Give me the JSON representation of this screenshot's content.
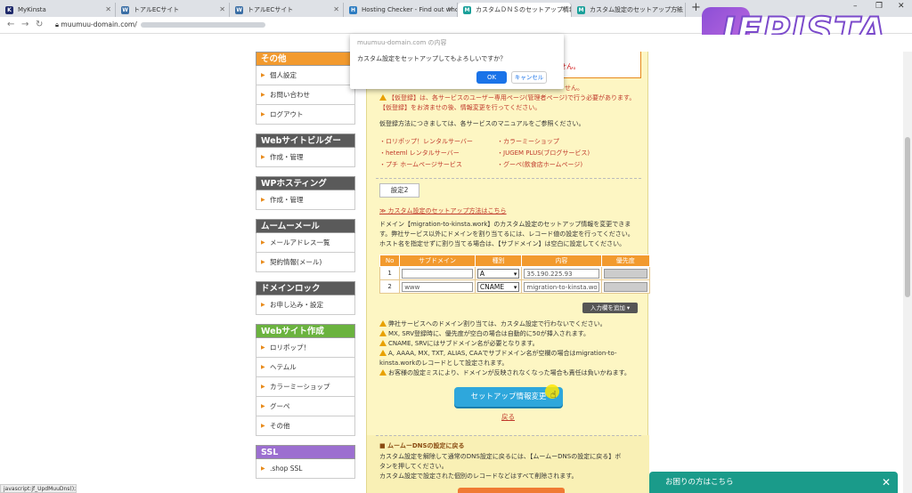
{
  "browser": {
    "tabs": [
      {
        "title": "MyKinsta",
        "fav": "K",
        "fav_color": "#1f2a6b"
      },
      {
        "title": "トアルECサイト",
        "fav": "W",
        "fav_color": "#3a6ea5"
      },
      {
        "title": "トアルECサイト",
        "fav": "W",
        "fav_color": "#3a6ea5"
      },
      {
        "title": "Hosting Checker - Find out who",
        "fav": "H",
        "fav_color": "#2d7cc1"
      },
      {
        "title": "カスタムＤＮＳのセットアップ情報変",
        "fav": "M",
        "fav_color": "#1aa09a"
      },
      {
        "title": "カスタム設定のセットアップ方法 - ムー",
        "fav": "M",
        "fav_color": "#1aa09a"
      }
    ],
    "url": "muumuu-domain.com/",
    "window_controls": [
      "–",
      "❐",
      "✕"
    ],
    "logo_text": "JEPISTA"
  },
  "sidebar": {
    "groups": [
      {
        "title": "その他",
        "color": "#f29a2e",
        "items": [
          "個人設定",
          "お問い合わせ",
          "ログアウト"
        ]
      },
      {
        "title": "Webサイトビルダー",
        "color": "#5a5a5a",
        "items": [
          "作成・管理"
        ]
      },
      {
        "title": "WPホスティング",
        "color": "#5a5a5a",
        "items": [
          "作成・管理"
        ]
      },
      {
        "title": "ムームーメール",
        "color": "#5a5a5a",
        "items": [
          "メールアドレス一覧",
          "契約情報(メール)"
        ]
      },
      {
        "title": "ドメインロック",
        "color": "#5a5a5a",
        "items": [
          "お申し込み・設定"
        ]
      },
      {
        "title": "Webサイト作成",
        "color": "#6bb33f",
        "items": [
          "ロリポップ！",
          "ヘテムル",
          "カラーミーショップ",
          "グーペ",
          "その他"
        ]
      },
      {
        "title": "SSL",
        "color": "#9c6fd0",
        "items": [
          ".shop SSL"
        ]
      }
    ]
  },
  "dialog": {
    "title": "muumuu-domain.com の内容",
    "message": "カスタム設定をセットアップしてもよろしいですか？",
    "ok": "OK",
    "cancel": "キャンセル"
  },
  "main": {
    "top_warning_tail": "ません。",
    "lines": [
      "せん。",
      "【仮登録】は、各サービスのユーザー専用ページ(管理者ページ)で行う必要があります。",
      "【仮登録】をお済ませの後、情報変更を行ってください。",
      "仮登録方法につきましては、各サービスのマニュアルをご参照ください。"
    ],
    "services_left": [
      "・ロリポップ！レンタルサーバー",
      "・heteml レンタルサーバー",
      "・プチ ホームページサービス"
    ],
    "services_right": [
      "・カラーミーショップ",
      "・JUGEM PLUS(ブログサービス)",
      "・グーペ(飲食店ホームページ)"
    ],
    "setting_label": "設定2",
    "setup_link": "≫ カスタム設定のセットアップ方法はこちら",
    "desc": [
      "ドメイン【migration-to-kinsta.work】のカスタム設定のセットアップ情報を変更できま",
      "す。弊社サービス以外にドメインを割り当てるには、レコード値の設定を行ってください。",
      "ホスト名を指定せずに割り当てる場合は、【サブドメイン】は空白に設定してください。"
    ],
    "table": {
      "headers": [
        "No",
        "サブドメイン",
        "種別",
        "内容",
        "優先度"
      ],
      "rows": [
        {
          "no": "1",
          "subdomain": "",
          "type": "A",
          "content": "35.190.225.93",
          "priority": ""
        },
        {
          "no": "2",
          "subdomain": "www",
          "type": "CNAME",
          "content": "migration-to-kinsta.wo",
          "priority": ""
        }
      ]
    },
    "add_row": "入力欄を追加 ▾",
    "notes": [
      "弊社サービスへのドメイン割り当ては、カスタム設定で行わないでください。",
      "MX, SRV登録時に、優先度が空白の場合は自動的に50が挿入されます。",
      "CNAME, SRVにはサブドメイン名が必要となります。",
      "A, AAAA, MX, TXT, ALIAS, CAAでサブドメイン名が空欄の場合はmigration-to-",
      "kinsta.workのレコードとして設定されます。",
      "お客様の設定ミスにより、ドメインが反映されなくなった場合も責任は負いかねます。"
    ],
    "setup_button": "セットアップ情報変更",
    "back": "戻る",
    "section2_title": "■ ムームーDNSの設定に戻る",
    "section2_lines": [
      "カスタム設定を解除して通常のDNS設定に戻るには、【ムームーDNSの設定に戻る】ボ",
      "タンを押してください。",
      "カスタム設定で設定された個別のレコードなどはすべて削除されます。"
    ]
  },
  "chat": {
    "label": "お困りの方はこちら",
    "close": "✕"
  },
  "status": {
    "text": "javascript:jf_UpdMuuDns();"
  }
}
